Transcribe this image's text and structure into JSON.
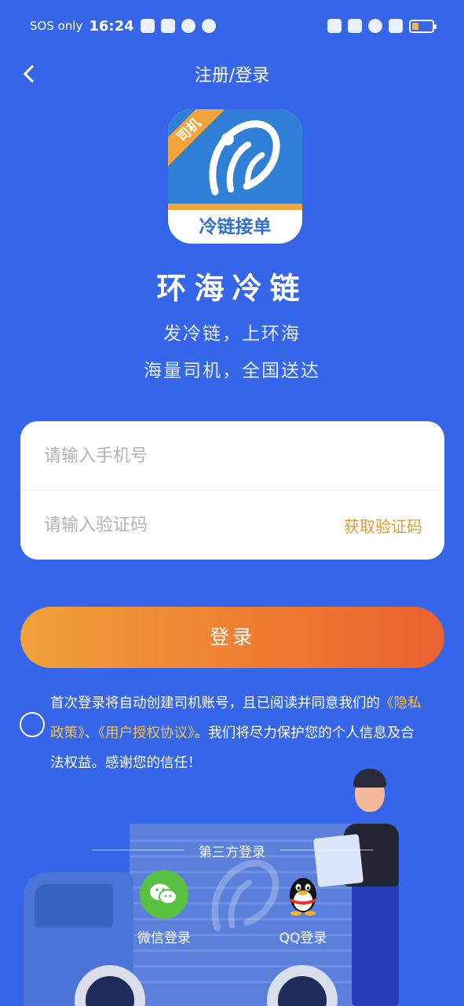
{
  "status_bar": {
    "carrier": "SOS only",
    "time": "16:24"
  },
  "nav": {
    "title": "注册/登录"
  },
  "logo": {
    "badge": "司机",
    "caption": "冷链接单"
  },
  "app_name": "环海冷链",
  "slogan": {
    "line1": "发冷链，上环海",
    "line2": "海量司机，全国送达"
  },
  "form": {
    "phone_placeholder": "请输入手机号",
    "code_placeholder": "请输入验证码",
    "get_code_label": "获取验证码"
  },
  "login_button": "登录",
  "agreement": {
    "text_before": "首次登录将自动创建司机账号，且已阅读并同意我们的",
    "privacy_link": "《隐私政策》",
    "separator": "、",
    "terms_link": "《用户授权协议》",
    "text_after": "。我们将尽力保护您的个人信息及合法权益。感谢您的信任！"
  },
  "third_party": {
    "title": "第三方登录",
    "wechat_label": "微信登录",
    "qq_label": "QQ登录"
  },
  "colors": {
    "background": "#3566ea",
    "accent": "#e39b2b",
    "button_start": "#f1a13a",
    "button_end": "#ea6130",
    "wechat": "#59c142"
  }
}
